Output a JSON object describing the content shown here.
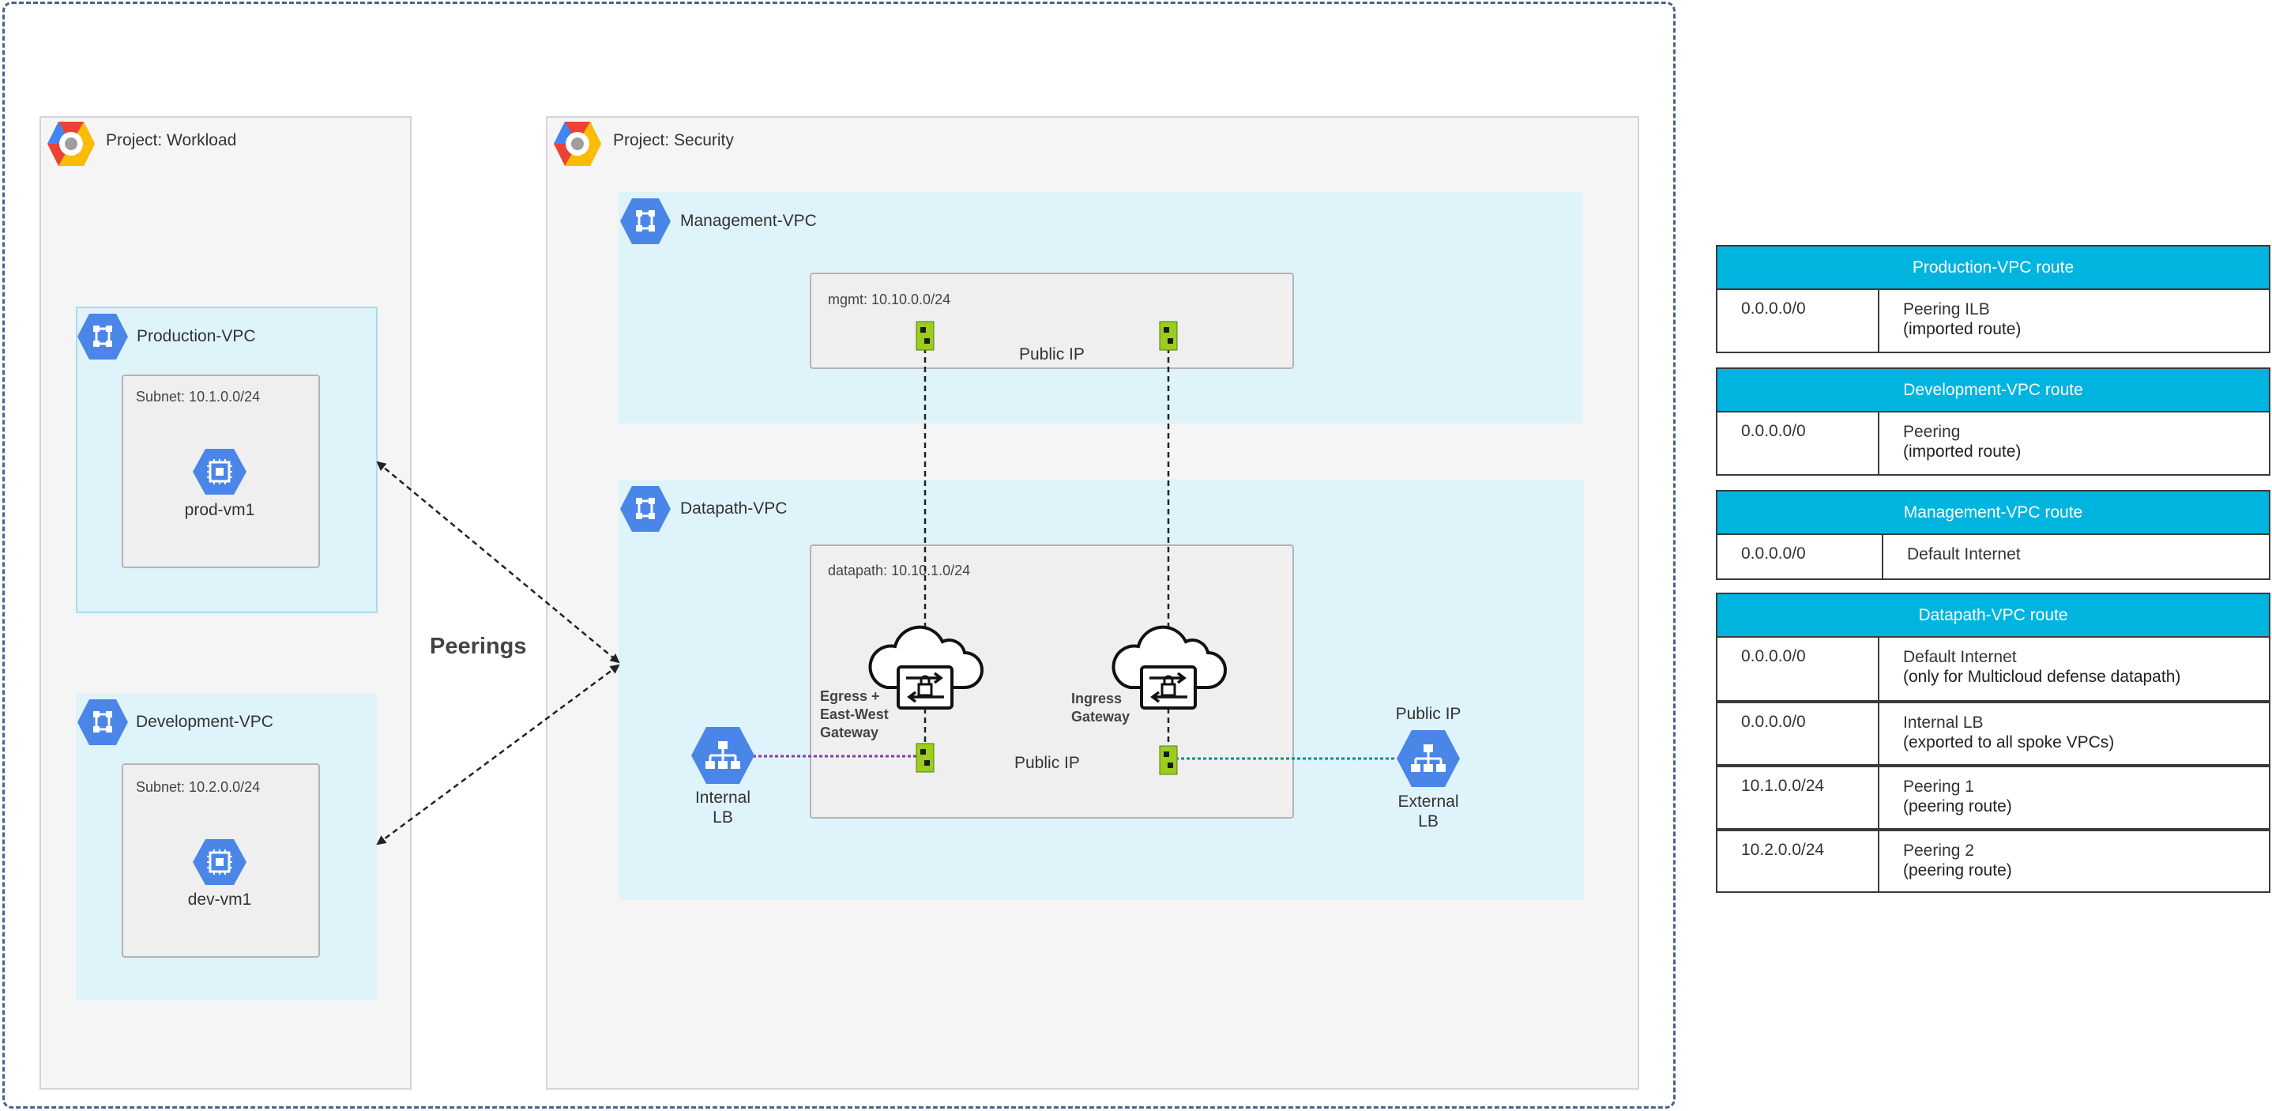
{
  "projects": {
    "workload": {
      "title": "Project: Workload"
    },
    "security": {
      "title": "Project: Security"
    }
  },
  "vpcs": {
    "production": {
      "title": "Production-VPC",
      "subnet": "Subnet:  10.1.0.0/24",
      "vm": "prod-vm1"
    },
    "development": {
      "title": "Development-VPC",
      "subnet": "Subnet:  10.2.0.0/24",
      "vm": "dev-vm1"
    },
    "management": {
      "title": "Management-VPC",
      "subnet": "mgmt: 10.10.0.0/24",
      "public_ip": "Public IP"
    },
    "datapath": {
      "title": "Datapath-VPC",
      "subnet": "datapath: 10.10.1.0/24",
      "public_ip": "Public IP",
      "egress_gateway": [
        "Egress +",
        "East-West",
        "Gateway"
      ],
      "ingress_gateway": [
        "Ingress",
        "Gateway"
      ],
      "internal_lb": [
        "Internal",
        "LB"
      ],
      "external_lb": [
        "External",
        "LB"
      ],
      "external_public_ip": "Public IP"
    }
  },
  "peerings_label": "Peerings",
  "route_tables": [
    {
      "title": "Production-VPC route",
      "rows": [
        {
          "dest": "0.0.0.0/0",
          "next": [
            "Peering ILB",
            "(imported route)"
          ]
        }
      ]
    },
    {
      "title": "Development-VPC route",
      "rows": [
        {
          "dest": "0.0.0.0/0",
          "next": [
            "Peering",
            "(imported route)"
          ]
        }
      ]
    },
    {
      "title": "Management-VPC route",
      "rows": [
        {
          "dest": "0.0.0.0/0",
          "next": [
            "Default Internet"
          ]
        }
      ]
    },
    {
      "title": "Datapath-VPC route",
      "rows": [
        {
          "dest": "0.0.0.0/0",
          "next": [
            "Default Internet",
            "(only for Multicloud defense datapath)"
          ]
        },
        {
          "dest": "0.0.0.0/0",
          "next": [
            "Internal LB",
            "(exported to all spoke VPCs)"
          ]
        },
        {
          "dest": "10.1.0.0/24",
          "next": [
            "Peering 1",
            "(peering route)"
          ]
        },
        {
          "dest": "10.2.0.0/24",
          "next": [
            "Peering 2",
            "(peering route)"
          ]
        }
      ]
    }
  ],
  "colors": {
    "gcp_blue": "#4a86e8",
    "vpc_fill": "#dff3fa",
    "route_header": "#00b4e0",
    "nic_green": "#9acd1e",
    "outer_dash": "#4a6290"
  }
}
